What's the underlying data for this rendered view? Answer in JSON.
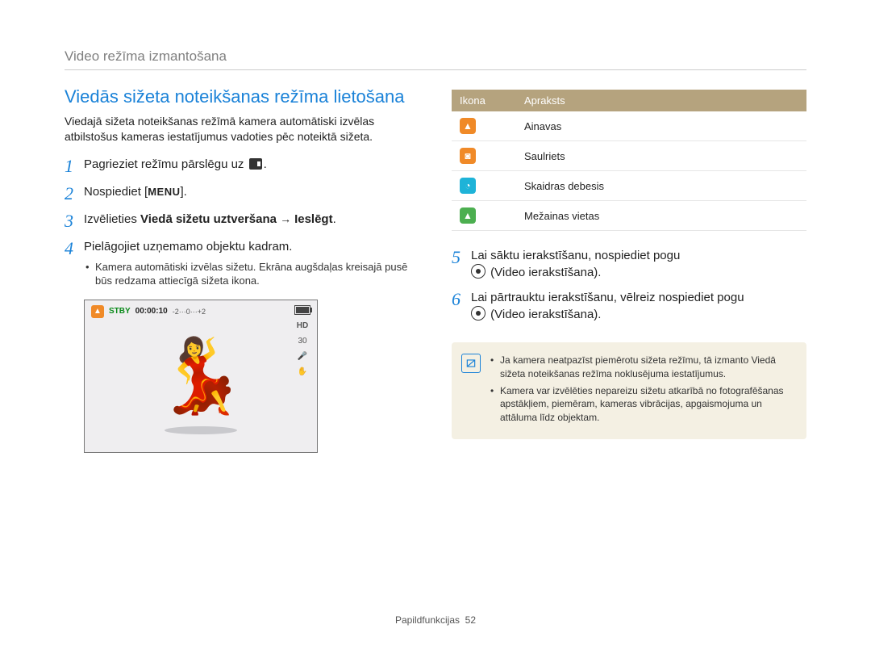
{
  "breadcrumb": "Video režīma izmantošana",
  "title": "Viedās sižeta noteikšanas režīma lietošana",
  "intro": "Viedajā sižeta noteikšanas režīmā kamera automātiski izvēlas atbilstošus kameras iestatījumus vadoties pēc noteiktā sižeta.",
  "steps": {
    "s1": "Pagrieziet režīmu pārslēgu uz",
    "s1_after": ".",
    "s2_pre": "Nospiediet [",
    "s2_menu": "MENU",
    "s2_post": "].",
    "s3_a": "Izvēlieties",
    "s3_b": "Viedā sižetu uztveršana",
    "s3_c": "Ieslēgt",
    "s4": "Pielāgojiet uzņemamo objektu kadram.",
    "s4_sub": "Kamera automātiski izvēlas sižetu. Ekrāna augšdaļas kreisajā pusē būs redzama attiecīgā sižeta ikona.",
    "s5_a": "Lai sāktu ierakstīšanu, nospiediet pogu",
    "s5_b": "(Video ierakstīšana).",
    "s6_a": "Lai pārtrauktu ierakstīšanu, vēlreiz nospiediet pogu",
    "s6_b": "(Video ierakstīšana)."
  },
  "camera": {
    "stby": "STBY",
    "time": "00:00:10",
    "hd": "HD",
    "fps": "30"
  },
  "table": {
    "head_icon": "Ikona",
    "head_desc": "Apraksts",
    "rows": [
      {
        "glyph": "▲",
        "cls": "orange",
        "label": "Ainavas"
      },
      {
        "glyph": "◙",
        "cls": "orange",
        "label": "Saulriets"
      },
      {
        "glyph": "◔",
        "cls": "blue",
        "label": "Skaidras debesis"
      },
      {
        "glyph": "▲",
        "cls": "green",
        "label": "Mežainas vietas"
      }
    ]
  },
  "note": {
    "n1": "Ja kamera neatpazīst piemērotu sižeta režīmu, tā izmanto Viedā sižeta noteikšanas režīma noklusējuma iestatījumus.",
    "n2": "Kamera var izvēlēties nepareizu sižetu atkarībā no fotografēšanas apstākļiem, piemēram, kameras vibrācijas, apgaismojuma un attāluma līdz objektam."
  },
  "footer_a": "Papildfunkcijas",
  "footer_b": "52"
}
